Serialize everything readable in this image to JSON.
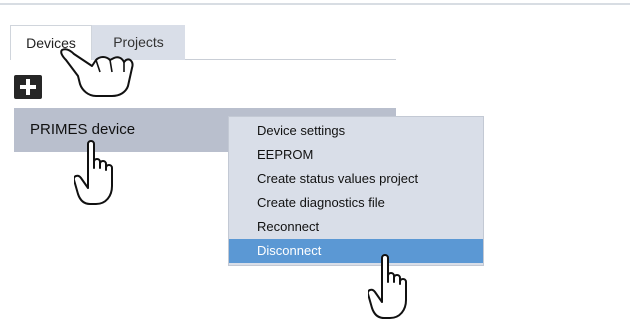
{
  "tabs": [
    {
      "label": "Devices",
      "active": true
    },
    {
      "label": "Projects",
      "active": false
    }
  ],
  "toolbar": {
    "add_icon": "plus-icon"
  },
  "devices": [
    {
      "label": "PRIMES device"
    }
  ],
  "context_menu": {
    "items": [
      {
        "label": "Device settings"
      },
      {
        "label": "EEPROM"
      },
      {
        "label": "Create status values project"
      },
      {
        "label": "Create diagnostics file"
      },
      {
        "label": "Reconnect"
      },
      {
        "label": "Disconnect",
        "selected": true
      }
    ]
  },
  "colors": {
    "selected_item": "#5b98d4",
    "menu_background": "#d9dee8",
    "device_row": "#b9bfcd",
    "inactive_tab": "#d9dee8"
  },
  "icons": [
    "pointing-hand-icon",
    "plus-icon"
  ]
}
